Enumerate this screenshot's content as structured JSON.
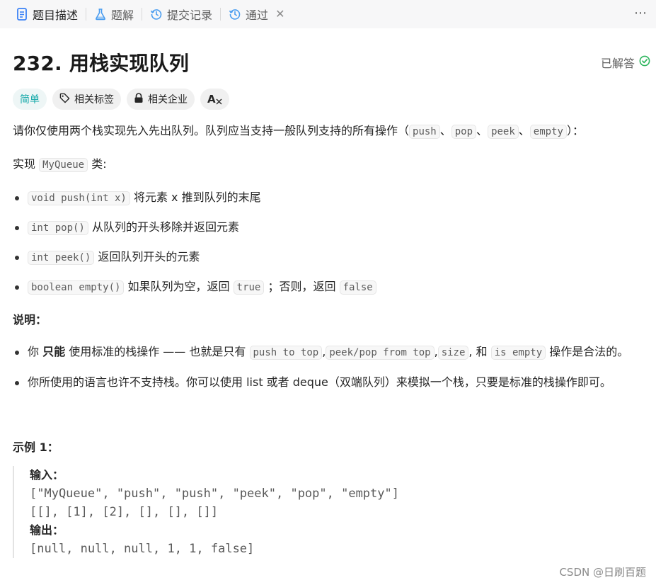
{
  "tabs": [
    {
      "label": "题目描述",
      "icon": "description-icon",
      "active": true
    },
    {
      "label": "题解",
      "icon": "flask-icon",
      "active": false
    },
    {
      "label": "提交记录",
      "icon": "history-icon",
      "active": false
    },
    {
      "label": "通过",
      "icon": "history-icon",
      "active": false,
      "closable": true
    }
  ],
  "close_glyph": "✕",
  "more_glyph": "⋯",
  "problem": {
    "title": "232. 用栈实现队列",
    "status": "已解答",
    "status_color": "#2db55d"
  },
  "tags": {
    "difficulty": "简单",
    "related_tags": "相关标签",
    "related_companies": "相关企业",
    "translate_glyph": "A"
  },
  "description": {
    "intro_text": "请你仅使用两个栈实现先入先出队列。队列应当支持一般队列支持的所有操作（",
    "intro_ops": [
      "push",
      "pop",
      "peek",
      "empty"
    ],
    "intro_sep": "、",
    "intro_end": "）：",
    "impl_prefix": "实现",
    "impl_code": "MyQueue",
    "impl_suffix": "类:",
    "methods": [
      {
        "code": "void push(int x)",
        "text": "将元素 x 推到队列的末尾"
      },
      {
        "code": "int pop()",
        "text": "从队列的开头移除并返回元素"
      },
      {
        "code": "int peek()",
        "text": "返回队列开头的元素"
      },
      {
        "code": "boolean empty()",
        "text": "如果队列为空，返回",
        "code2": "true",
        "text2": "；否则，返回",
        "code3": "false"
      }
    ]
  },
  "notes": {
    "heading": "说明：",
    "item1": {
      "prefix": "你",
      "bold": "只能",
      "middle": "使用标准的栈操作 —— 也就是只有",
      "ops": [
        "push to top",
        "peek/pop from top",
        "size",
        "is empty"
      ],
      "comma": ",",
      "and": "和",
      "suffix": "操作是合法的。"
    },
    "item2": "你所使用的语言也许不支持栈。你可以使用 list 或者 deque（双端队列）来模拟一个栈，只要是标准的栈操作即可。"
  },
  "example": {
    "heading": "示例 1：",
    "input_label": "输入：",
    "input_line1": "[\"MyQueue\", \"push\", \"push\", \"peek\", \"pop\", \"empty\"]",
    "input_line2": "[[], [1], [2], [], [], []]",
    "output_label": "输出：",
    "output_line": "[null, null, null, 1, 1, false]"
  },
  "watermark": "CSDN @日刷百题"
}
